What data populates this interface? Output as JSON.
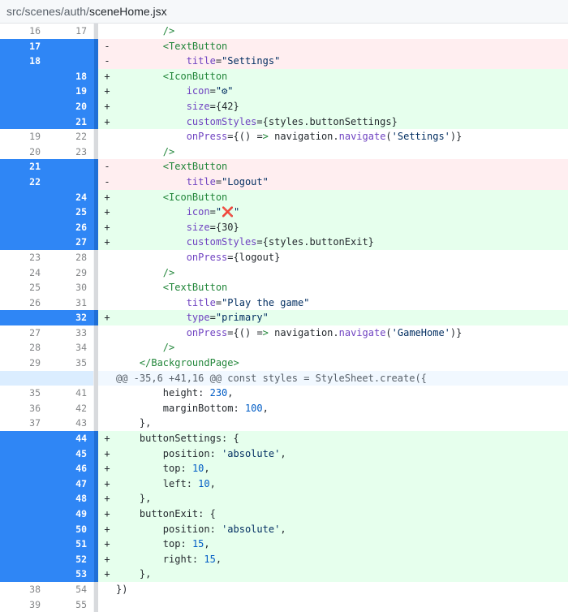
{
  "file": {
    "path": "src/scenes/auth/",
    "name": "sceneHome.jsx"
  },
  "lines": [
    {
      "type": "ctx",
      "sel": false,
      "old": "16",
      "new": "17",
      "marker": "",
      "code": "        />"
    },
    {
      "type": "del",
      "sel": true,
      "old": "17",
      "new": "",
      "marker": "-",
      "code": "        <TextButton"
    },
    {
      "type": "del",
      "sel": true,
      "old": "18",
      "new": "",
      "marker": "-",
      "code": "            title=\"Settings\""
    },
    {
      "type": "add",
      "sel": true,
      "old": "",
      "new": "18",
      "marker": "+",
      "code": "        <IconButton"
    },
    {
      "type": "add",
      "sel": true,
      "old": "",
      "new": "19",
      "marker": "+",
      "code": "            icon=\"⚙\""
    },
    {
      "type": "add",
      "sel": true,
      "old": "",
      "new": "20",
      "marker": "+",
      "code": "            size={42}"
    },
    {
      "type": "add",
      "sel": true,
      "old": "",
      "new": "21",
      "marker": "+",
      "code": "            customStyles={styles.buttonSettings}"
    },
    {
      "type": "ctx",
      "sel": false,
      "old": "19",
      "new": "22",
      "marker": "",
      "code": "            onPress={() => navigation.navigate('Settings')}"
    },
    {
      "type": "ctx",
      "sel": false,
      "old": "20",
      "new": "23",
      "marker": "",
      "code": "        />"
    },
    {
      "type": "del",
      "sel": true,
      "old": "21",
      "new": "",
      "marker": "-",
      "code": "        <TextButton"
    },
    {
      "type": "del",
      "sel": true,
      "old": "22",
      "new": "",
      "marker": "-",
      "code": "            title=\"Logout\""
    },
    {
      "type": "add",
      "sel": true,
      "old": "",
      "new": "24",
      "marker": "+",
      "code": "        <IconButton"
    },
    {
      "type": "add",
      "sel": true,
      "old": "",
      "new": "25",
      "marker": "+",
      "code": "            icon=\"❌\""
    },
    {
      "type": "add",
      "sel": true,
      "old": "",
      "new": "26",
      "marker": "+",
      "code": "            size={30}"
    },
    {
      "type": "add",
      "sel": true,
      "old": "",
      "new": "27",
      "marker": "+",
      "code": "            customStyles={styles.buttonExit}"
    },
    {
      "type": "ctx",
      "sel": false,
      "old": "23",
      "new": "28",
      "marker": "",
      "code": "            onPress={logout}"
    },
    {
      "type": "ctx",
      "sel": false,
      "old": "24",
      "new": "29",
      "marker": "",
      "code": "        />"
    },
    {
      "type": "ctx",
      "sel": false,
      "old": "25",
      "new": "30",
      "marker": "",
      "code": "        <TextButton"
    },
    {
      "type": "ctx",
      "sel": false,
      "old": "26",
      "new": "31",
      "marker": "",
      "code": "            title=\"Play the game\""
    },
    {
      "type": "add",
      "sel": true,
      "old": "",
      "new": "32",
      "marker": "+",
      "code": "            type=\"primary\""
    },
    {
      "type": "ctx",
      "sel": false,
      "old": "27",
      "new": "33",
      "marker": "",
      "code": "            onPress={() => navigation.navigate('GameHome')}"
    },
    {
      "type": "ctx",
      "sel": false,
      "old": "28",
      "new": "34",
      "marker": "",
      "code": "        />"
    },
    {
      "type": "ctx",
      "sel": false,
      "old": "29",
      "new": "35",
      "marker": "",
      "code": "    </BackgroundPage>"
    },
    {
      "type": "hunk",
      "sel": false,
      "old": "",
      "new": "",
      "marker": "",
      "code": "@@ -35,6 +41,16 @@ const styles = StyleSheet.create({"
    },
    {
      "type": "ctx",
      "sel": false,
      "old": "35",
      "new": "41",
      "marker": "",
      "code": "        height: 230,"
    },
    {
      "type": "ctx",
      "sel": false,
      "old": "36",
      "new": "42",
      "marker": "",
      "code": "        marginBottom: 100,"
    },
    {
      "type": "ctx",
      "sel": false,
      "old": "37",
      "new": "43",
      "marker": "",
      "code": "    },"
    },
    {
      "type": "add",
      "sel": true,
      "old": "",
      "new": "44",
      "marker": "+",
      "code": "    buttonSettings: {"
    },
    {
      "type": "add",
      "sel": true,
      "old": "",
      "new": "45",
      "marker": "+",
      "code": "        position: 'absolute',"
    },
    {
      "type": "add",
      "sel": true,
      "old": "",
      "new": "46",
      "marker": "+",
      "code": "        top: 10,"
    },
    {
      "type": "add",
      "sel": true,
      "old": "",
      "new": "47",
      "marker": "+",
      "code": "        left: 10,"
    },
    {
      "type": "add",
      "sel": true,
      "old": "",
      "new": "48",
      "marker": "+",
      "code": "    },"
    },
    {
      "type": "add",
      "sel": true,
      "old": "",
      "new": "49",
      "marker": "+",
      "code": "    buttonExit: {"
    },
    {
      "type": "add",
      "sel": true,
      "old": "",
      "new": "50",
      "marker": "+",
      "code": "        position: 'absolute',"
    },
    {
      "type": "add",
      "sel": true,
      "old": "",
      "new": "51",
      "marker": "+",
      "code": "        top: 15,"
    },
    {
      "type": "add",
      "sel": true,
      "old": "",
      "new": "52",
      "marker": "+",
      "code": "        right: 15,"
    },
    {
      "type": "add",
      "sel": true,
      "old": "",
      "new": "53",
      "marker": "+",
      "code": "    },"
    },
    {
      "type": "ctx",
      "sel": false,
      "old": "38",
      "new": "54",
      "marker": "",
      "code": "})"
    },
    {
      "type": "ctx",
      "sel": false,
      "old": "39",
      "new": "55",
      "marker": "",
      "code": ""
    }
  ]
}
